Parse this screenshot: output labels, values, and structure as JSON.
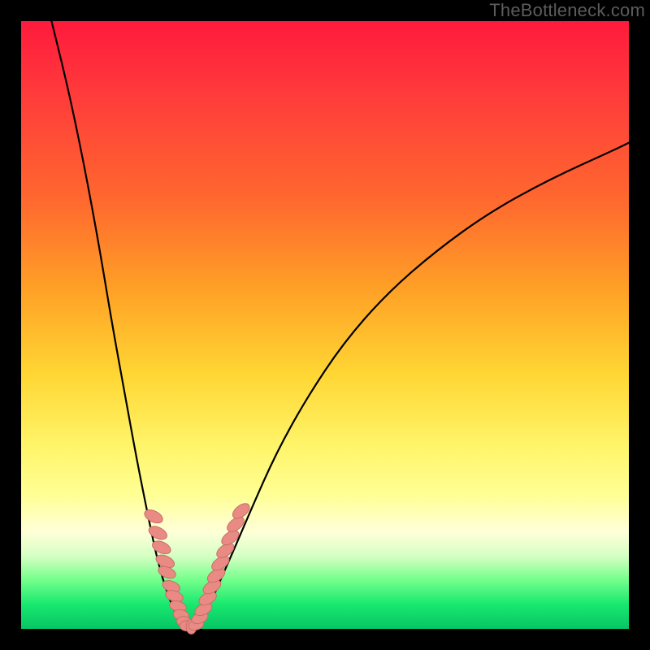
{
  "watermark": "TheBottleneck.com",
  "colors": {
    "curve": "#000000",
    "dots_fill": "#e98b84",
    "dots_stroke": "#c86e66",
    "gradient_top": "#ff1a3c",
    "gradient_bottom": "#07c565",
    "frame_bg": "#000000"
  },
  "chart_data": {
    "type": "line",
    "title": "",
    "xlabel": "",
    "ylabel": "",
    "xlim": [
      0,
      100
    ],
    "ylim": [
      0,
      100
    ],
    "grid": false,
    "legend": false,
    "description": "Two black curves on a vertical red-to-green gradient forming a V with its vertex near the bottom; salmon-colored oval dots cluster on the lower portions of both arms near the vertex.",
    "series": [
      {
        "name": "left-arm",
        "x": [
          5,
          7,
          9,
          11,
          13,
          15,
          17,
          19,
          21,
          22.5,
          24,
          25.2,
          26,
          26.6,
          27,
          27.4
        ],
        "y": [
          100,
          92,
          83,
          73,
          62,
          50,
          39,
          28,
          18,
          11,
          6,
          3,
          1.5,
          0.7,
          0.3,
          0.1
        ]
      },
      {
        "name": "right-arm",
        "x": [
          27.4,
          28,
          29,
          30,
          31.5,
          33,
          35,
          38,
          42,
          47,
          53,
          60,
          68,
          77,
          87,
          98,
          100
        ],
        "y": [
          0.1,
          0.3,
          1,
          2.5,
          5,
          8.5,
          13,
          20,
          29,
          38,
          47,
          55,
          62,
          68.5,
          74,
          79,
          80
        ]
      }
    ],
    "dots": [
      {
        "cx": 21.8,
        "cy": 18.5,
        "rx": 0.9,
        "ry": 1.6,
        "rot": -64
      },
      {
        "cx": 22.5,
        "cy": 15.8,
        "rx": 0.9,
        "ry": 1.6,
        "rot": -64
      },
      {
        "cx": 23.1,
        "cy": 13.4,
        "rx": 0.9,
        "ry": 1.6,
        "rot": -66
      },
      {
        "cx": 23.7,
        "cy": 11.1,
        "rx": 0.9,
        "ry": 1.6,
        "rot": -66
      },
      {
        "cx": 24.0,
        "cy": 9.3,
        "rx": 0.85,
        "ry": 1.5,
        "rot": -68
      },
      {
        "cx": 24.7,
        "cy": 7.0,
        "rx": 0.85,
        "ry": 1.5,
        "rot": -70
      },
      {
        "cx": 25.2,
        "cy": 5.4,
        "rx": 0.85,
        "ry": 1.5,
        "rot": -72
      },
      {
        "cx": 25.8,
        "cy": 3.7,
        "rx": 0.85,
        "ry": 1.4,
        "rot": -74
      },
      {
        "cx": 26.3,
        "cy": 2.3,
        "rx": 0.85,
        "ry": 1.3,
        "rot": -78
      },
      {
        "cx": 26.8,
        "cy": 1.2,
        "rx": 0.85,
        "ry": 1.2,
        "rot": -84
      },
      {
        "cx": 27.3,
        "cy": 0.5,
        "rx": 0.85,
        "ry": 1.2,
        "rot": -90
      },
      {
        "cx": 28.0,
        "cy": 0.35,
        "rx": 0.85,
        "ry": 1.2,
        "rot": 0
      },
      {
        "cx": 28.8,
        "cy": 0.7,
        "rx": 0.85,
        "ry": 1.3,
        "rot": 72
      },
      {
        "cx": 29.4,
        "cy": 1.8,
        "rx": 0.85,
        "ry": 1.4,
        "rot": 68
      },
      {
        "cx": 30.0,
        "cy": 3.2,
        "rx": 0.85,
        "ry": 1.5,
        "rot": 65
      },
      {
        "cx": 30.7,
        "cy": 5.0,
        "rx": 0.9,
        "ry": 1.55,
        "rot": 62
      },
      {
        "cx": 31.4,
        "cy": 6.9,
        "rx": 0.9,
        "ry": 1.6,
        "rot": 60
      },
      {
        "cx": 32.1,
        "cy": 8.8,
        "rx": 0.9,
        "ry": 1.6,
        "rot": 58
      },
      {
        "cx": 32.8,
        "cy": 10.8,
        "rx": 0.9,
        "ry": 1.6,
        "rot": 56
      },
      {
        "cx": 33.6,
        "cy": 12.9,
        "rx": 0.9,
        "ry": 1.6,
        "rot": 55
      },
      {
        "cx": 34.4,
        "cy": 15.0,
        "rx": 0.9,
        "ry": 1.6,
        "rot": 54
      },
      {
        "cx": 35.3,
        "cy": 17.2,
        "rx": 0.9,
        "ry": 1.6,
        "rot": 53
      },
      {
        "cx": 36.2,
        "cy": 19.4,
        "rx": 0.9,
        "ry": 1.6,
        "rot": 52
      }
    ]
  }
}
